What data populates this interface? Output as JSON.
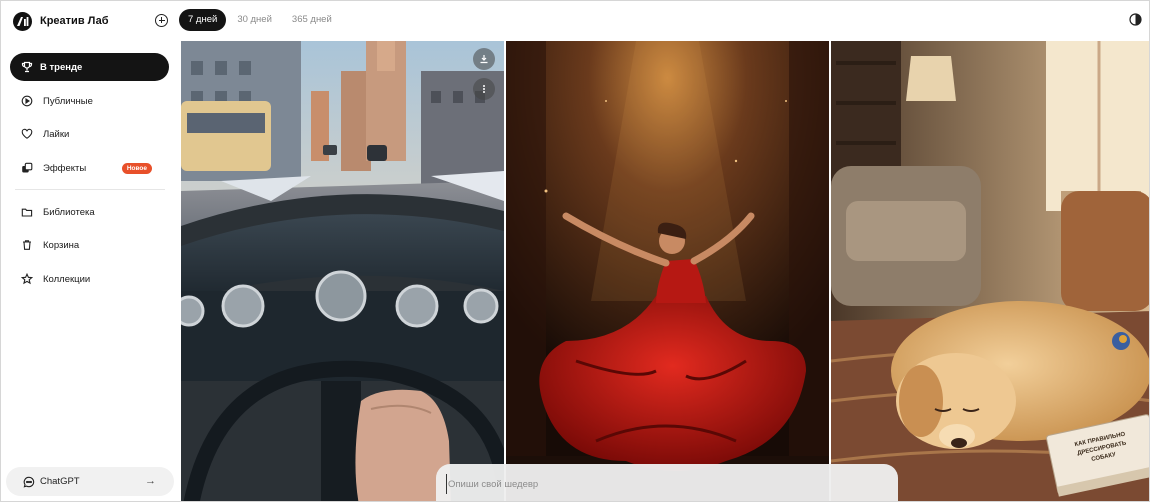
{
  "brand": {
    "name": "Креатив Лаб"
  },
  "sidebar": {
    "items": [
      {
        "label": "В тренде",
        "icon": "trophy-icon"
      },
      {
        "label": "Публичные",
        "icon": "play-circle-icon"
      },
      {
        "label": "Лайки",
        "icon": "heart-icon"
      },
      {
        "label": "Эффекты",
        "icon": "effects-icon",
        "badge": "Новое"
      },
      {
        "label": "Библиотека",
        "icon": "folder-icon"
      },
      {
        "label": "Корзина",
        "icon": "trash-icon"
      },
      {
        "label": "Коллекции",
        "icon": "star-icon"
      }
    ],
    "chatgpt": {
      "label": "ChatGPT",
      "icon": "chat-icon"
    }
  },
  "tabs": [
    {
      "label": "7 дней",
      "active": true
    },
    {
      "label": "30 дней",
      "active": false
    },
    {
      "label": "365 дней",
      "active": false
    }
  ],
  "gallery": [
    {
      "subject": "winter city street viewed from a retro car steering wheel",
      "actions": [
        "download-icon",
        "more-icon"
      ]
    },
    {
      "subject": "dancer in red dress under spotlight",
      "actions": []
    },
    {
      "subject": "golden retriever puppy sleeping on rug with book",
      "book_title": "КАК ПРАВИЛЬНО ДРЕССИРОВАТЬ СОБАКУ"
    }
  ],
  "prompt": {
    "placeholder": "Опиши свой шедевр"
  },
  "colors": {
    "accent": "#141414",
    "badge": "#e8502a"
  }
}
